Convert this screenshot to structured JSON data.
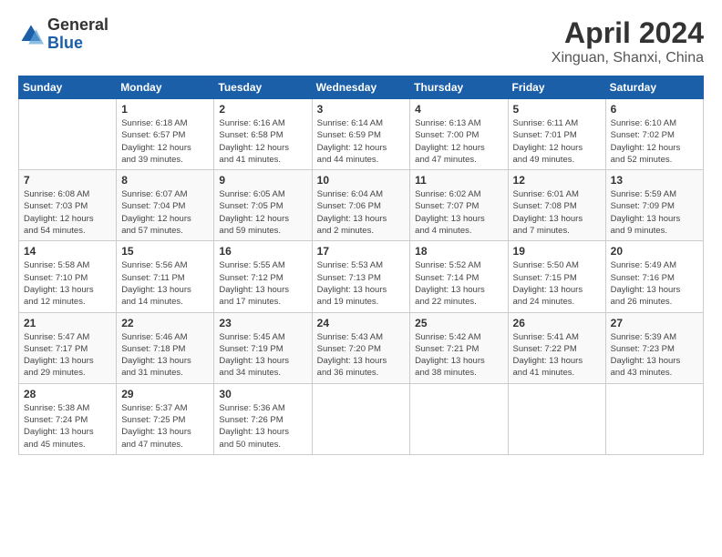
{
  "logo": {
    "general": "General",
    "blue": "Blue"
  },
  "title": "April 2024",
  "location": "Xinguan, Shanxi, China",
  "weekdays": [
    "Sunday",
    "Monday",
    "Tuesday",
    "Wednesday",
    "Thursday",
    "Friday",
    "Saturday"
  ],
  "weeks": [
    [
      {
        "day": "",
        "info": ""
      },
      {
        "day": "1",
        "info": "Sunrise: 6:18 AM\nSunset: 6:57 PM\nDaylight: 12 hours\nand 39 minutes."
      },
      {
        "day": "2",
        "info": "Sunrise: 6:16 AM\nSunset: 6:58 PM\nDaylight: 12 hours\nand 41 minutes."
      },
      {
        "day": "3",
        "info": "Sunrise: 6:14 AM\nSunset: 6:59 PM\nDaylight: 12 hours\nand 44 minutes."
      },
      {
        "day": "4",
        "info": "Sunrise: 6:13 AM\nSunset: 7:00 PM\nDaylight: 12 hours\nand 47 minutes."
      },
      {
        "day": "5",
        "info": "Sunrise: 6:11 AM\nSunset: 7:01 PM\nDaylight: 12 hours\nand 49 minutes."
      },
      {
        "day": "6",
        "info": "Sunrise: 6:10 AM\nSunset: 7:02 PM\nDaylight: 12 hours\nand 52 minutes."
      }
    ],
    [
      {
        "day": "7",
        "info": "Sunrise: 6:08 AM\nSunset: 7:03 PM\nDaylight: 12 hours\nand 54 minutes."
      },
      {
        "day": "8",
        "info": "Sunrise: 6:07 AM\nSunset: 7:04 PM\nDaylight: 12 hours\nand 57 minutes."
      },
      {
        "day": "9",
        "info": "Sunrise: 6:05 AM\nSunset: 7:05 PM\nDaylight: 12 hours\nand 59 minutes."
      },
      {
        "day": "10",
        "info": "Sunrise: 6:04 AM\nSunset: 7:06 PM\nDaylight: 13 hours\nand 2 minutes."
      },
      {
        "day": "11",
        "info": "Sunrise: 6:02 AM\nSunset: 7:07 PM\nDaylight: 13 hours\nand 4 minutes."
      },
      {
        "day": "12",
        "info": "Sunrise: 6:01 AM\nSunset: 7:08 PM\nDaylight: 13 hours\nand 7 minutes."
      },
      {
        "day": "13",
        "info": "Sunrise: 5:59 AM\nSunset: 7:09 PM\nDaylight: 13 hours\nand 9 minutes."
      }
    ],
    [
      {
        "day": "14",
        "info": "Sunrise: 5:58 AM\nSunset: 7:10 PM\nDaylight: 13 hours\nand 12 minutes."
      },
      {
        "day": "15",
        "info": "Sunrise: 5:56 AM\nSunset: 7:11 PM\nDaylight: 13 hours\nand 14 minutes."
      },
      {
        "day": "16",
        "info": "Sunrise: 5:55 AM\nSunset: 7:12 PM\nDaylight: 13 hours\nand 17 minutes."
      },
      {
        "day": "17",
        "info": "Sunrise: 5:53 AM\nSunset: 7:13 PM\nDaylight: 13 hours\nand 19 minutes."
      },
      {
        "day": "18",
        "info": "Sunrise: 5:52 AM\nSunset: 7:14 PM\nDaylight: 13 hours\nand 22 minutes."
      },
      {
        "day": "19",
        "info": "Sunrise: 5:50 AM\nSunset: 7:15 PM\nDaylight: 13 hours\nand 24 minutes."
      },
      {
        "day": "20",
        "info": "Sunrise: 5:49 AM\nSunset: 7:16 PM\nDaylight: 13 hours\nand 26 minutes."
      }
    ],
    [
      {
        "day": "21",
        "info": "Sunrise: 5:47 AM\nSunset: 7:17 PM\nDaylight: 13 hours\nand 29 minutes."
      },
      {
        "day": "22",
        "info": "Sunrise: 5:46 AM\nSunset: 7:18 PM\nDaylight: 13 hours\nand 31 minutes."
      },
      {
        "day": "23",
        "info": "Sunrise: 5:45 AM\nSunset: 7:19 PM\nDaylight: 13 hours\nand 34 minutes."
      },
      {
        "day": "24",
        "info": "Sunrise: 5:43 AM\nSunset: 7:20 PM\nDaylight: 13 hours\nand 36 minutes."
      },
      {
        "day": "25",
        "info": "Sunrise: 5:42 AM\nSunset: 7:21 PM\nDaylight: 13 hours\nand 38 minutes."
      },
      {
        "day": "26",
        "info": "Sunrise: 5:41 AM\nSunset: 7:22 PM\nDaylight: 13 hours\nand 41 minutes."
      },
      {
        "day": "27",
        "info": "Sunrise: 5:39 AM\nSunset: 7:23 PM\nDaylight: 13 hours\nand 43 minutes."
      }
    ],
    [
      {
        "day": "28",
        "info": "Sunrise: 5:38 AM\nSunset: 7:24 PM\nDaylight: 13 hours\nand 45 minutes."
      },
      {
        "day": "29",
        "info": "Sunrise: 5:37 AM\nSunset: 7:25 PM\nDaylight: 13 hours\nand 47 minutes."
      },
      {
        "day": "30",
        "info": "Sunrise: 5:36 AM\nSunset: 7:26 PM\nDaylight: 13 hours\nand 50 minutes."
      },
      {
        "day": "",
        "info": ""
      },
      {
        "day": "",
        "info": ""
      },
      {
        "day": "",
        "info": ""
      },
      {
        "day": "",
        "info": ""
      }
    ]
  ]
}
